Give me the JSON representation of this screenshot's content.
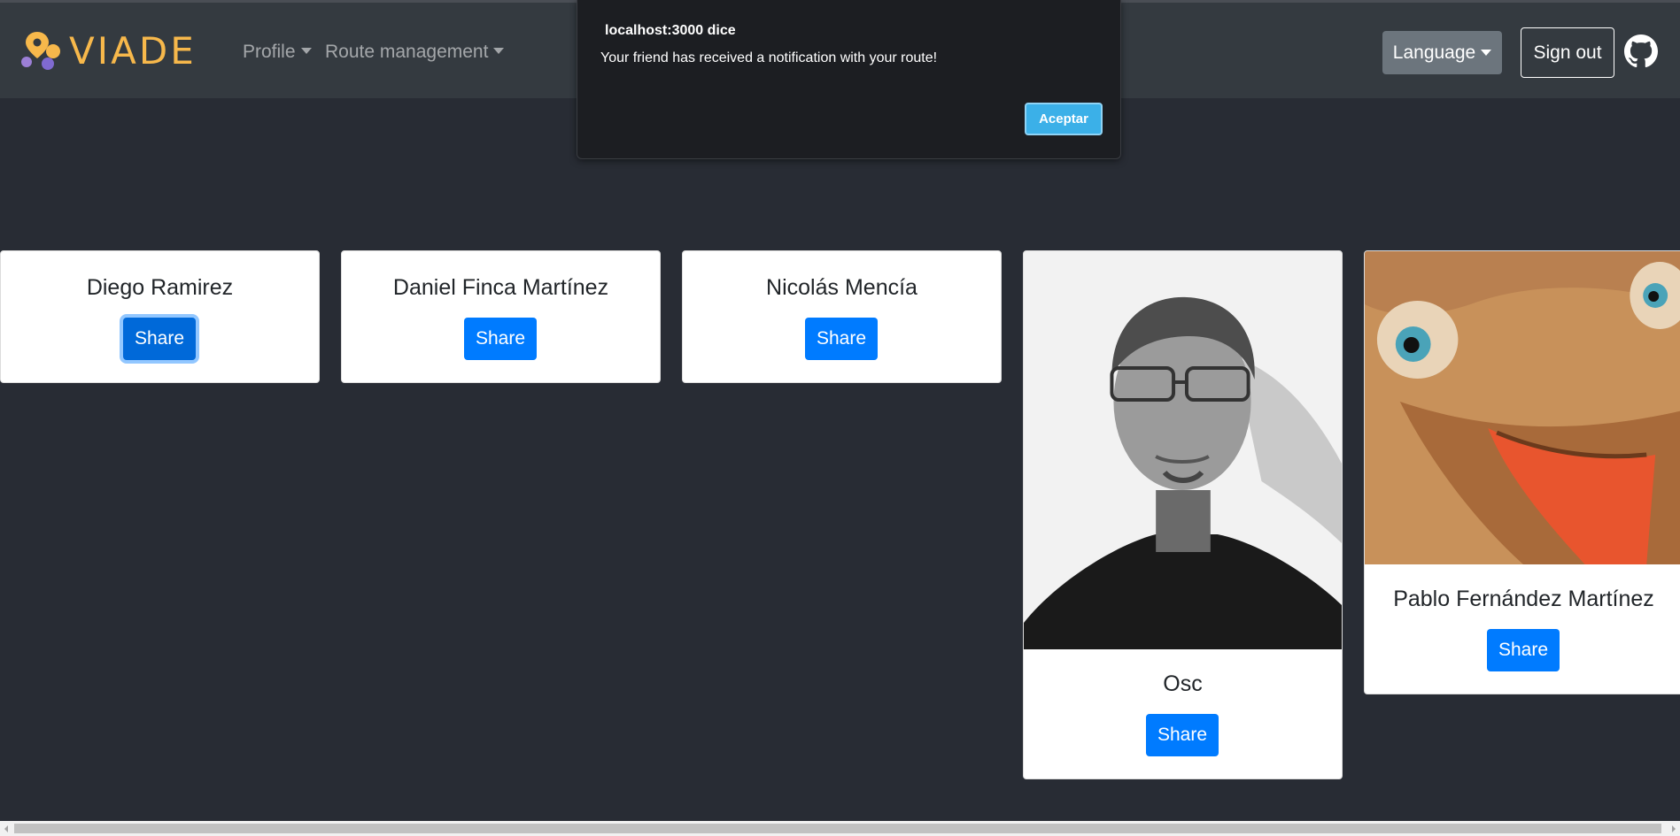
{
  "navbar": {
    "brand": "VIADE",
    "profile_label": "Profile",
    "route_management_label": "Route management",
    "language_label": "Language",
    "signout_label": "Sign out"
  },
  "dialog": {
    "title": "localhost:3000 dice",
    "message": "Your friend has received a notification with your route!",
    "ok_label": "Aceptar"
  },
  "friends": [
    {
      "name": "Diego Ramirez",
      "share_label": "Share",
      "has_photo": false,
      "focused": true
    },
    {
      "name": "Daniel Finca Martínez",
      "share_label": "Share",
      "has_photo": false,
      "focused": false
    },
    {
      "name": "Nicolás Mencía",
      "share_label": "Share",
      "has_photo": false,
      "focused": false
    },
    {
      "name": "Osc",
      "share_label": "Share",
      "has_photo": true,
      "photo": "grayscale-portrait",
      "focused": false
    },
    {
      "name": "Pablo Fernández Martínez",
      "share_label": "Share",
      "has_photo": true,
      "photo": "cartoon-dolphin",
      "focused": false
    }
  ],
  "colors": {
    "page_bg": "#282c34",
    "navbar_bg": "#343a40",
    "brand": "#f7b84b",
    "primary": "#007bff",
    "secondary": "#6c757d",
    "dialog_ok": "#3bb0e8"
  }
}
